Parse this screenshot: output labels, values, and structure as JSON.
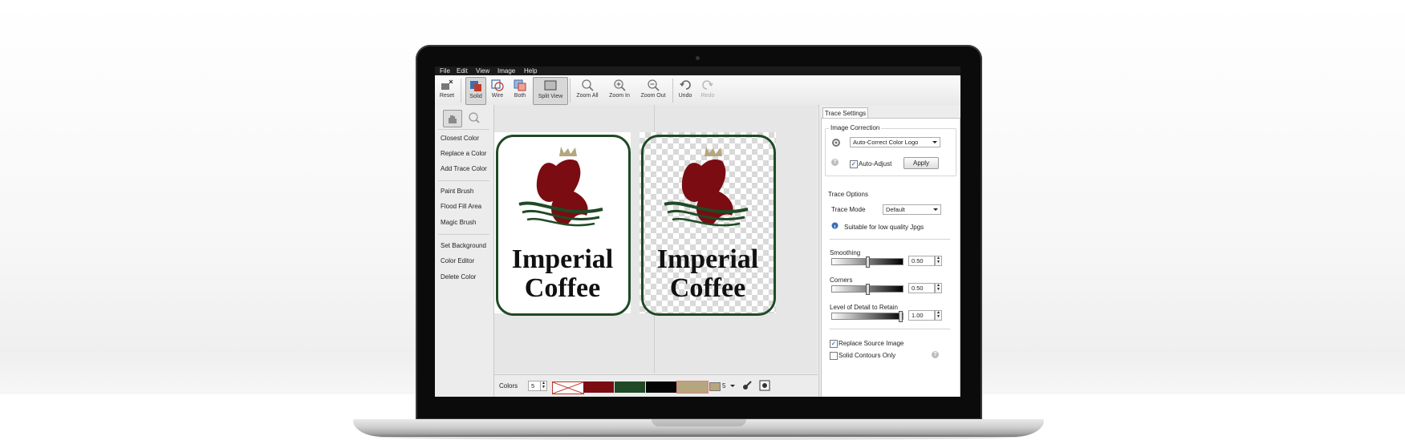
{
  "menu": [
    "File",
    "Edit",
    "View",
    "Image",
    "Help"
  ],
  "toolbar": {
    "reset": "Reset",
    "solid": "Solid",
    "wire": "Wire",
    "both": "Both",
    "split": "Split View",
    "zoom_all": "Zoom All",
    "zoom_in": "Zoom In",
    "zoom_out": "Zoom Out",
    "undo": "Undo",
    "redo": "Redo"
  },
  "tools": [
    "Closest Color",
    "Replace a Color",
    "Add Trace Color",
    "Paint Brush",
    "Flood Fill Area",
    "Magic Brush",
    "Set Background",
    "Color Editor",
    "Delete Color"
  ],
  "logo": {
    "line1": "Imperial",
    "line2": "Coffee"
  },
  "bottombar": {
    "colors_label": "Colors",
    "colors_value": "5",
    "count_value": "5",
    "palette": [
      "#ffffff",
      "#7a0c12",
      "#1f4a25",
      "#050505",
      "#b5a67e"
    ]
  },
  "trace": {
    "tab": "Trace Settings",
    "image_correction": "Image Correction",
    "correction_value": "Auto-Correct Color Logo",
    "auto_adjust": "Auto-Adjust",
    "apply": "Apply",
    "trace_options": "Trace Options",
    "trace_mode_label": "Trace Mode",
    "trace_mode_value": "Default",
    "hint": "Suitable for low quality Jpgs",
    "smoothing_label": "Smoothing",
    "smoothing_value": "0.50",
    "smoothing_level": 0.5,
    "corners_label": "Corners",
    "corners_value": "0.50",
    "corners_level": 0.5,
    "detail_label": "Level of Detail to Retain",
    "detail_value": "1.00",
    "detail_level": 1.0,
    "replace_source": "Replace Source Image",
    "solid_contours": "Solid Contours Only"
  }
}
